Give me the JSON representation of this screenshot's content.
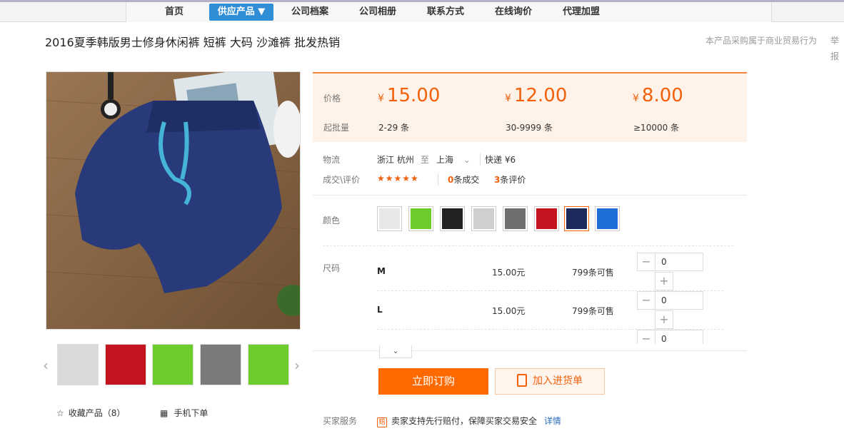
{
  "nav": {
    "items": [
      {
        "label": "首页"
      },
      {
        "label": "供应产品 ▼"
      },
      {
        "label": "公司档案"
      },
      {
        "label": "公司相册"
      },
      {
        "label": "联系方式"
      },
      {
        "label": "在线询价"
      },
      {
        "label": "代理加盟"
      }
    ],
    "active_color": "#2f8ed6"
  },
  "product": {
    "title": "2016夏季韩版男士修身休闲裤 短裤 大码 沙滩裤 批发热销",
    "trade_note": "本产品采购属于商业贸易行为",
    "report": "举报"
  },
  "price_panel": {
    "price_label": "价格",
    "moq_label": "起批量",
    "currency": "¥",
    "tiers": [
      {
        "price": "15.00",
        "qty": "2-29 条"
      },
      {
        "price": "12.00",
        "qty": "30-9999 条"
      },
      {
        "price": "8.00",
        "qty": "≥10000 条"
      }
    ],
    "accent": "#f2600c"
  },
  "logistics": {
    "label": "物流",
    "from": "浙江 杭州",
    "to_word": "至",
    "to": "上海",
    "express": "快递 ¥6"
  },
  "deals": {
    "label": "成交\\评价",
    "stars": "★★★★★",
    "deal_count": "0",
    "deal_text": "条成交",
    "review_count": "3",
    "review_text": "条评价"
  },
  "color": {
    "label": "颜色",
    "swatches": [
      {
        "color": "#e8e8e8"
      },
      {
        "color": "#6ccc2c"
      },
      {
        "color": "#222222"
      },
      {
        "color": "#cfcfcf"
      },
      {
        "color": "#6f6f6f"
      },
      {
        "color": "#c4141f"
      },
      {
        "color": "#1e2a5c",
        "selected": true
      },
      {
        "color": "#1f6fd6"
      }
    ]
  },
  "sizes": {
    "label": "尺码",
    "rows": [
      {
        "name": "M",
        "price": "15.00元",
        "stock": "799条可售",
        "qty": "0"
      },
      {
        "name": "L",
        "price": "15.00元",
        "stock": "799条可售",
        "qty": "0"
      },
      {
        "name": "",
        "price": "",
        "stock": "",
        "qty": "0"
      }
    ],
    "minus": "−",
    "plus": "+"
  },
  "actions": {
    "buy": "立即订购",
    "cart": "加入进货单"
  },
  "left": {
    "fav": "收藏产品（8）",
    "mobile": "手机下单"
  },
  "service": {
    "label": "买家服务",
    "text": "卖家支持先行赔付，保障买家交易安全",
    "link": "详情"
  },
  "thumbs": [
    {
      "color": "#d9d9d9"
    },
    {
      "color": "#c4141f"
    },
    {
      "color": "#6ccc2c"
    },
    {
      "color": "#7a7a7a"
    },
    {
      "color": "#6ccc2c"
    }
  ]
}
